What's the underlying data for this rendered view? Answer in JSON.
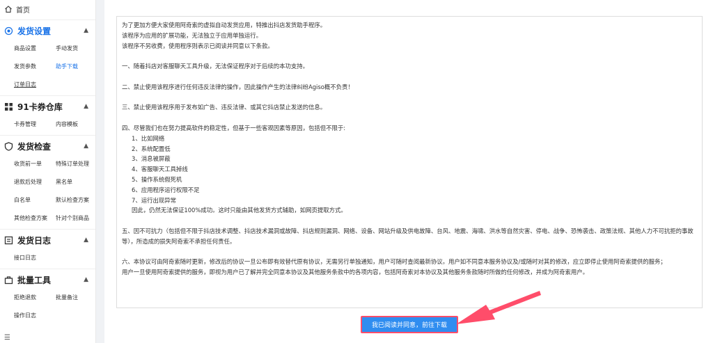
{
  "sidebar": {
    "home": "首页",
    "sections": [
      {
        "title": "发货设置",
        "items": [
          "商品设置",
          "手动发货",
          "发货参数",
          "助手下载",
          "订单日志"
        ]
      },
      {
        "title": "91卡券仓库",
        "items": [
          "卡券管理",
          "内容模板"
        ]
      },
      {
        "title": "发货检查",
        "items": [
          "收货前一单",
          "特殊订单处理",
          "退款后处理",
          "黑名单",
          "白名单",
          "默认检查方案",
          "其他检查方案",
          "针对个别商品"
        ]
      },
      {
        "title": "发货日志",
        "items": [
          "接口日志"
        ]
      },
      {
        "title": "批量工具",
        "items": [
          "拒绝退款",
          "批量备注",
          "操作日志"
        ]
      }
    ]
  },
  "terms": {
    "intro": [
      "为了更加方便大家使用阿奇索的虚拟自动发货应用，特推出抖店发货助手程序。",
      "该程序为应用的扩展功能，无法独立于应用单独运行。",
      "该程序不另收费，使用程序则表示已阅读并同意以下条款。"
    ],
    "c1": "一、随着抖店对客服聊天工具升级，无法保证程序对于后续的本功支持。",
    "c2": "二、禁止使用该程序进行任何违反法律的操作，因此操作产生的法律纠纷Agiso概不负责！",
    "c3": "三、禁止使用该程序用于发布如广告、违反法律、或其它抖店禁止发送的信息。",
    "c4": "四、尽管我们也在努力提高软件的稳定性，但基于一些客观因素等原因，包括但不限于:",
    "c4_items": [
      "1、比如网络",
      "2、系统配置低",
      "3、消息被屏蔽",
      "4、客服聊天工具掉线",
      "5、操作系统假死机",
      "6、应用程序运行权限不足",
      "7、运行出现异常"
    ],
    "c4_end": "因此，仍然无法保证100%成功。这时只能由其他发货方式辅助，如网页提取方式。",
    "c5": "五、因不可抗力（包括但不限于抖店技术调整、抖店技术漏洞或故障、抖店规则漏洞、网络、设备、网站升级及供电故障、台风、地震、海啸、洪水等自然灾害、停电、战争、恐怖袭击、政策法规、其他人力不可抗拒的事故等），所造成的损失阿奇索不承担任何责任。",
    "c6": "六、本协议可由阿奇索随时更新，修改后的协议一旦公布即有效替代原有协议，无需另行单独通知，用户可随时查阅最新协议。用户如不同意本服务协议及/或随时对其的修改，应立即停止使用阿奇索提供的服务；",
    "c7": "用户一旦使用阿奇索提供的服务，即视为用户已了解并完全同意本协议及其他服务条款中的各项内容，包括阿奇索对本协议及其他服务条款随时所做的任何修改，并成为阿奇索用户。"
  },
  "agree_button": "我已阅读并同意，前往下载",
  "colors": {
    "accent": "#1a73e8",
    "button": "#2f8df0",
    "arrow": "#ff4d6a"
  },
  "icons": {
    "home": "home-icon",
    "settings": "target-icon",
    "warehouse": "grid-icon",
    "check": "shield-icon",
    "log": "log-icon",
    "tools": "briefcase-icon"
  }
}
